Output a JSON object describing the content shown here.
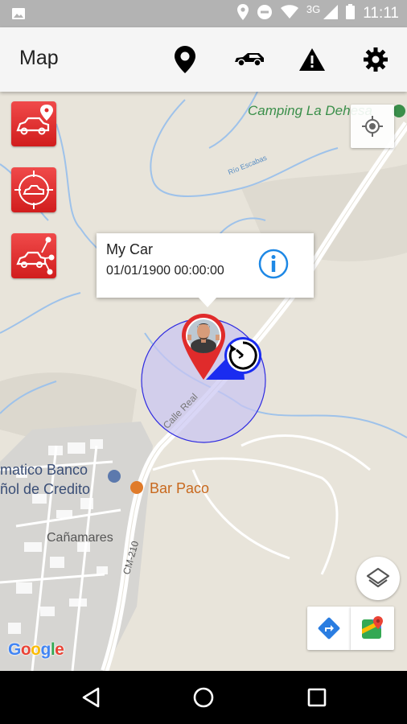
{
  "status_bar": {
    "time": "11:11",
    "network": "3G",
    "icons": [
      "image-icon",
      "location-icon",
      "sync-icon",
      "wifi-icon",
      "signal-icon",
      "battery-icon"
    ]
  },
  "app_bar": {
    "title": "Map",
    "actions": [
      "map-marker-icon",
      "car-icon",
      "warning-icon",
      "gear-icon"
    ]
  },
  "side_buttons": [
    "car-location-icon",
    "car-target-icon",
    "car-share-icon"
  ],
  "map": {
    "labels": {
      "camping": "Camping La Dehesa",
      "river": "Río Escabas",
      "street": "Calle Real",
      "bank_line1": "matico Banco",
      "bank_line2": "ñol de Credito",
      "bar": "Bar Paco",
      "town": "Cañamares",
      "road": "CM-210"
    }
  },
  "info_window": {
    "name": "My Car",
    "date": "01/01/1900 00:00:00"
  },
  "google_logo": {
    "letters": [
      "G",
      "o",
      "o",
      "g",
      "l",
      "e"
    ],
    "colors": [
      "#4285F4",
      "#EA4335",
      "#FBBC05",
      "#4285F4",
      "#34A853",
      "#EA4335"
    ]
  },
  "colors": {
    "accent_red": "#e02b2b",
    "marker_blue": "#1a2cf0",
    "circle_fill": "#c9c4f2",
    "info_blue": "#1e88e5"
  }
}
